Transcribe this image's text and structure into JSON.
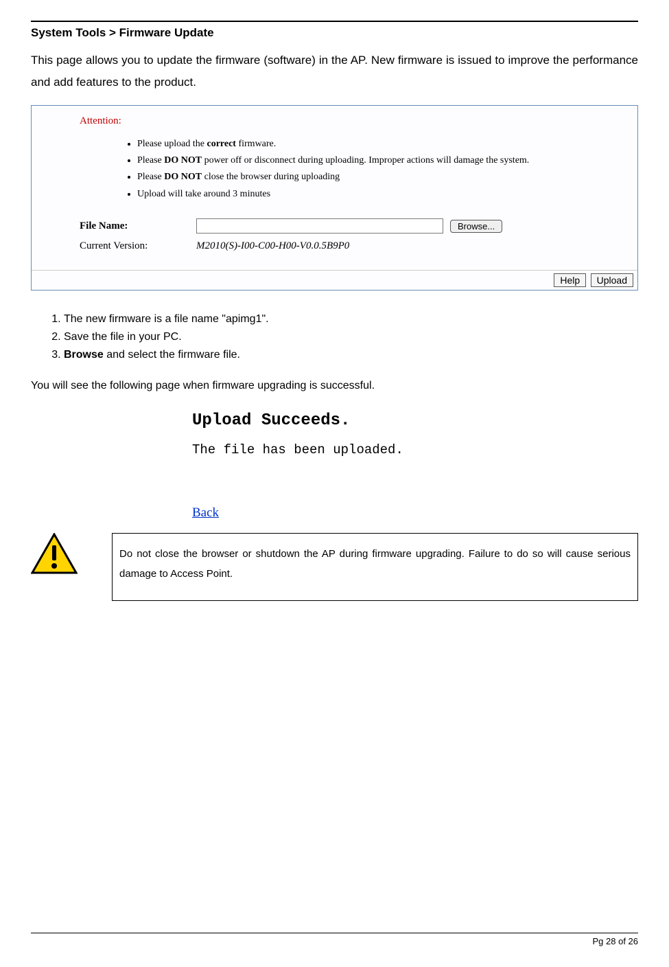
{
  "heading": "System Tools > Firmware Update",
  "intro": "This page allows you to update the firmware (software) in the AP. New firmware is issued to improve the performance and add features to the product.",
  "panel": {
    "attention_label": "Attention:",
    "bullets": {
      "b1_pre": "Please upload the ",
      "b1_bold": "correct",
      "b1_post": " firmware.",
      "b2_pre": "Please ",
      "b2_bold": "DO NOT",
      "b2_post": " power off or disconnect during uploading. Improper actions will damage the system.",
      "b3_pre": "Please ",
      "b3_bold": "DO NOT",
      "b3_post": " close the browser during uploading",
      "b4": "Upload will take around 3 minutes"
    },
    "file_name_label": "File Name:",
    "browse_label": "Browse...",
    "current_version_label": "Current Version:",
    "current_version_value": "M2010(S)-I00-C00-H00-V0.0.5B9P0",
    "help_label": "Help",
    "upload_label": "Upload"
  },
  "steps": {
    "s1": "The new firmware is a file name \"apimg1\".",
    "s2": "Save the file in your PC.",
    "s3_bold": "Browse",
    "s3_rest": " and select the firmware file."
  },
  "followup": "You will see the following page when firmware upgrading is successful.",
  "uploadSuccess": {
    "title": "Upload Succeeds.",
    "sub": "The file has been uploaded.",
    "back": "Back"
  },
  "warning_text": "Do not close the browser or shutdown the AP during firmware upgrading. Failure to do so will cause serious damage to Access Point.",
  "page_number": "Pg 28 of 26"
}
